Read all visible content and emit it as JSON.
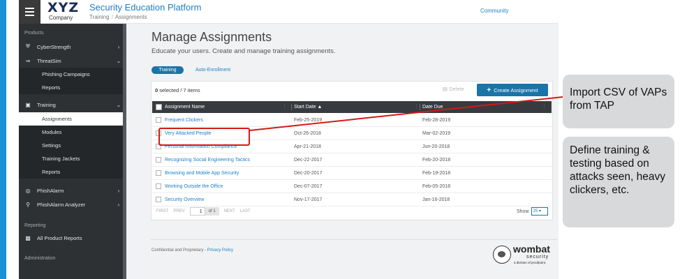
{
  "header": {
    "logo_text": "XYZ",
    "logo_subtext": "Company",
    "app_title": "Security Education Platform",
    "breadcrumb": [
      "Training",
      "Assignments"
    ],
    "community_link": "Community"
  },
  "sidebar": {
    "section_products": "Products",
    "section_reporting": "Reporting",
    "section_administration": "Administration",
    "items": {
      "cyberstrength": "CyberStrength",
      "threatsim": "ThreatSim",
      "phishing_campaigns": "Phishing Campaigns",
      "reports": "Reports",
      "training": "Training",
      "assignments": "Assignments",
      "modules": "Modules",
      "settings": "Settings",
      "training_jackets": "Training Jackets",
      "training_reports": "Reports",
      "phishalarm": "PhishAlarm",
      "phishalarm_analyzer": "PhishAlarm Analyzer",
      "all_product_reports": "All Product Reports"
    }
  },
  "main": {
    "title": "Manage Assignments",
    "subtitle": "Educate your users. Create and manage training assignments.",
    "tabs": {
      "training": "Training",
      "auto_enrollment": "Auto-Enrollment"
    },
    "selected_count": "0",
    "selected_suffix": "selected / 7 items",
    "delete_label": "Delete",
    "create_label": "Create Assignment"
  },
  "table": {
    "columns": {
      "name": "Assignment Name",
      "start": "Start Date",
      "due": "Date Due"
    },
    "rows": [
      {
        "name": "Frequent Clickers",
        "start": "Feb-25-2019",
        "due": "Feb-28-2019"
      },
      {
        "name": "Very Attacked People",
        "start": "Oct-26-2018",
        "due": "Mar-02-2019"
      },
      {
        "name": "Personal Information Compliance",
        "start": "Apr-21-2018",
        "due": "Jun-20-2018"
      },
      {
        "name": "Recognizing Social Engineering Tactics",
        "start": "Dec-22-2017",
        "due": "Feb-20-2018"
      },
      {
        "name": "Browsing and Mobile App Security",
        "start": "Dec-20-2017",
        "due": "Feb-19-2018"
      },
      {
        "name": "Working Outside the Office",
        "start": "Dec-07-2017",
        "due": "Feb-05-2018"
      },
      {
        "name": "Security Overview",
        "start": "Nov-17-2017",
        "due": "Jan-16-2018"
      }
    ]
  },
  "pagination": {
    "first": "FIRST",
    "prev": "PREV",
    "page": "1",
    "of": "of 1",
    "next": "NEXT",
    "last": "LAST",
    "show_label": "Show",
    "show_value": "25"
  },
  "footer": {
    "text": "Confidential and Proprietary - ",
    "link": "Privacy Policy",
    "brand": "wombat",
    "brand_sub": "security",
    "brand_tag": "a division of proofpoint."
  },
  "callouts": {
    "import": "Import CSV of VAPs from TAP",
    "define": "Define training & testing based on attacks seen, heavy clickers, etc."
  },
  "colors": {
    "accent": "#1a74a8",
    "link": "#1e7fc4",
    "sidebar": "#2e3134",
    "highlight": "#d51818"
  }
}
